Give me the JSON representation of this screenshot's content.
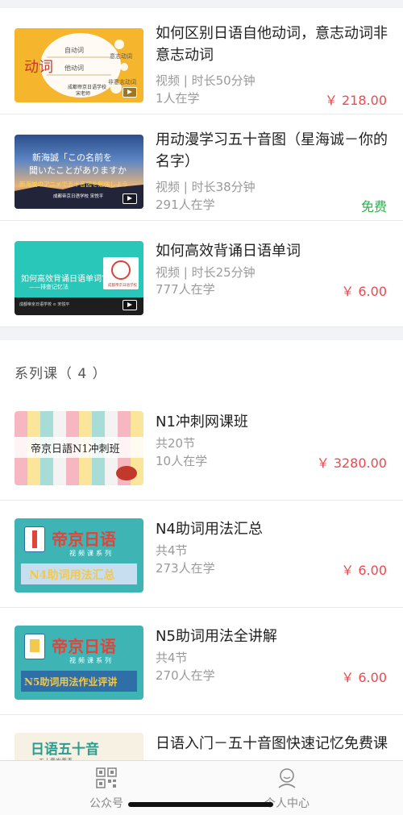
{
  "courses": [
    {
      "title": "如何区别日语自他动词，意志动词非意志动词",
      "meta": "视频 | 时长50分钟",
      "learners": "1人在学",
      "price": "￥ 218.00",
      "thumb": {
        "big": "动词",
        "lines": [
          "自动词",
          "他动词",
          "意志动词",
          "非意志动词"
        ],
        "school": "成都帝京日语学校",
        "teacher": "宋老师"
      }
    },
    {
      "title": "用动漫学习五十音图（星海诚－你的名字）",
      "meta": "视频 | 时长38分钟",
      "learners": "291人在学",
      "price": "免费",
      "thumb": {
        "line1": "新海誠「この名前を",
        "line2": "聞いたことがありますか",
        "line3": "新海誠のアニメで五十音図を勉強しよう",
        "school": "成都帝京日语学校  宋悦平"
      }
    },
    {
      "title": "如何高效背诵日语单词",
      "meta": "视频 | 时长25分钟",
      "learners": "777人在学",
      "price": "￥ 6.00",
      "thumb": {
        "line1": "如何高效背诵日语单词?",
        "line2": "——排查记忆法",
        "logo": "成都帝京日语学校",
        "footer": "成都帝京日语学校  ⊙  宋悦平"
      }
    }
  ],
  "series_section": {
    "title": "系列课（ 4 ）"
  },
  "series": [
    {
      "title": "N1冲刺网课班",
      "meta": "共20节",
      "learners": "10人在学",
      "price": "￥ 3280.00",
      "thumb": {
        "text": "帝京日語N1冲刺班"
      }
    },
    {
      "title": "N4助词用法汇总",
      "meta": "共4节",
      "learners": "273人在学",
      "price": "￥ 6.00",
      "thumb": {
        "brand": "帝京日语",
        "sub": "视频课系列",
        "tag": "N4助词用法汇总"
      }
    },
    {
      "title": "N5助词用法全讲解",
      "meta": "共4节",
      "learners": "270人在学",
      "price": "￥ 6.00",
      "thumb": {
        "brand": "帝京日语",
        "sub": "视频课系列",
        "tag": "N5助词用法作业评讲"
      }
    },
    {
      "title": "日语入门－五十音图快速记忆免费课",
      "thumb": {
        "text": "日语五十音",
        "sub": "五十音发音表"
      }
    }
  ],
  "tabbar": [
    {
      "label": "公众号",
      "icon": "qrcode-icon"
    },
    {
      "label": "个人中心",
      "icon": "user-icon"
    }
  ],
  "colors": {
    "price": "#f0474d",
    "free": "#29b24c",
    "muted": "#9a9a9a"
  }
}
